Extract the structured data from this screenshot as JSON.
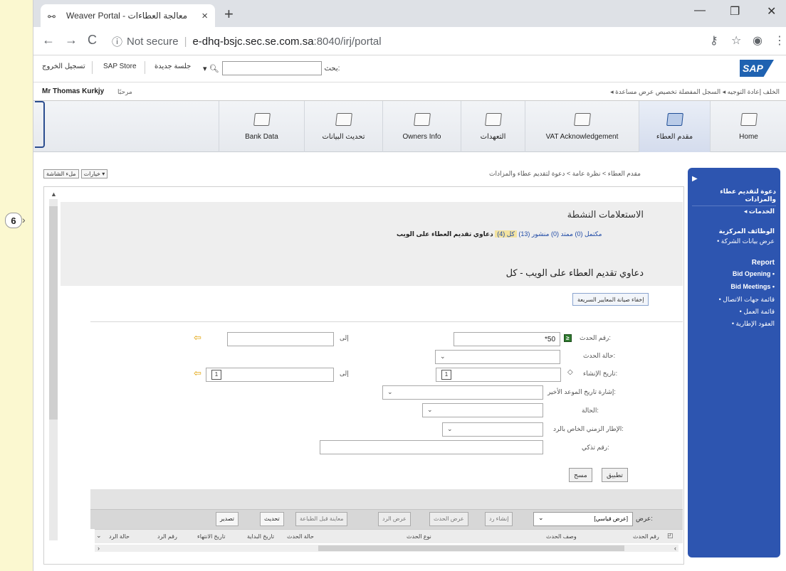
{
  "annotation": {
    "step_number": "6"
  },
  "browser": {
    "tab_title": "Weaver Portal - معالجة العطاءات",
    "url_security": "Not secure",
    "url_host": "e-dhq-bsjc.sec.se.com.sa",
    "url_path": ":8040/irj/portal"
  },
  "sap_header": {
    "logo": "SAP",
    "logoff": "تسجيل الخروج",
    "sap_store": "SAP Store",
    "new_session": "جلسة جديدة",
    "search_label": "بحث:",
    "search_value": ""
  },
  "user_bar": {
    "user_name": "Mr Thomas Kurkjy",
    "welcome": "مرحبًا",
    "history_links": "◂ الخلف  إعادة التوجيه ◂  السجل  المفضلة  تخصيص  عرض  مساعدة"
  },
  "nav_tabs": [
    {
      "label": "Home"
    },
    {
      "label": "مقدم العطاء"
    },
    {
      "label": "VAT Acknowledgement"
    },
    {
      "label": "التعهدات"
    },
    {
      "label": "Owners Info"
    },
    {
      "label": "تحديث البيانات"
    },
    {
      "label": "Bank Data"
    }
  ],
  "breadcrumb": "مقدم العطاء  >  نظرة عامة  >  دعوة لتقديم عطاء والمزادات",
  "page_options": {
    "full_screen": "ملء الشاشة",
    "options": "خيارات ▾"
  },
  "sidebar": {
    "header": "دعوة لتقديم عطاء والمزادات",
    "services": "◂ الخدمات",
    "central_functions": "الوظائف المركزية",
    "company_data": "• عرض بيانات الشركة",
    "report": "Report",
    "bid_opening": "Bid Opening •",
    "bid_meetings": "Bid Meetings •",
    "contact_list": "• قائمة جهات الاتصال",
    "work_list": "• قائمة العمل",
    "frame_agreements": "• العقود الإطارية"
  },
  "main": {
    "active_queries_title": "الاستعلامات النشطة",
    "queries_label": "دعاوي تقديم العطاء على الويب",
    "q_all": "كل (4)",
    "q_published": "منشور (13)",
    "q_extended": "ممتد (0)",
    "q_completed": "مكتمل (0)",
    "section_title": "دعاوي تقديم العطاء على الويب - كل",
    "hide_quick_criteria": "إخفاء صيانة المعايير السريعة"
  },
  "form": {
    "event_number_label": "رقم الحدث:",
    "event_number_value": "*50",
    "to_label_1": "إلى",
    "event_status_label": "حالة الحدث:",
    "created_date_label": "تاريخ الإنشاء:",
    "to_label_2": "إلى",
    "deadline_ref_label": "إشارة تاريخ الموعد الأخير:",
    "status_label": "الحالة:",
    "time_frame_label": "الإطار الزمني الخاص بالرد:",
    "product_label": "رقم تذكي:",
    "apply": "تطبيق",
    "clear": "مسح"
  },
  "table_toolbar": {
    "view_label": "عرض:",
    "view_value": "[عرض قياسي]",
    "create_response": "إنشاء رد",
    "view_event": "عرض الحدث",
    "view_response": "عرض الرد",
    "print_preview": "معاينة قبل الطباعة",
    "refresh": "تحديث",
    "export": "تصدير"
  },
  "columns": [
    {
      "label": "رقم الحدث"
    },
    {
      "label": "وصف الحدث"
    },
    {
      "label": "نوع الحدث"
    },
    {
      "label": "حالة الحدث"
    },
    {
      "label": "تاريخ البداية"
    },
    {
      "label": "تاريخ الانتهاء"
    },
    {
      "label": "رقم الرد"
    },
    {
      "label": "حالة الرد"
    }
  ]
}
